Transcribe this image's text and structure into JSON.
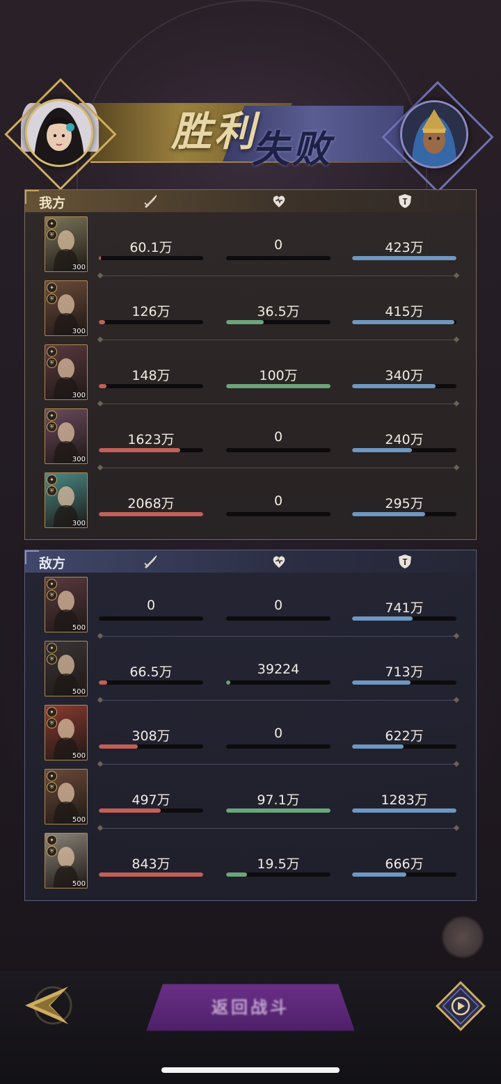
{
  "header": {
    "victory_label": "胜利",
    "defeat_label": "失败",
    "player_avatar_icon": "player-avatar",
    "enemy_avatar_icon": "enemy-avatar"
  },
  "columns": {
    "damage_icon": "sword-icon",
    "heal_icon": "heart-icon",
    "tank_icon": "shield-icon"
  },
  "colors": {
    "damage": "#c25f57",
    "heal": "#6aa67a",
    "tank": "#6d98c2",
    "gold": "#cfae5d"
  },
  "ally": {
    "title": "我方",
    "heroes": [
      {
        "level": "300",
        "damage": "60.1万",
        "heal": "0",
        "tank": "423万",
        "damage_pct": 2,
        "heal_pct": 0,
        "tank_pct": 100,
        "tint": "#7a7658"
      },
      {
        "level": "300",
        "damage": "126万",
        "heal": "36.5万",
        "tank": "415万",
        "damage_pct": 6,
        "heal_pct": 36,
        "tank_pct": 98,
        "tint": "#6a4a38"
      },
      {
        "level": "300",
        "damage": "148万",
        "heal": "100万",
        "tank": "340万",
        "damage_pct": 7,
        "heal_pct": 100,
        "tank_pct": 80,
        "tint": "#5a3a3e"
      },
      {
        "level": "300",
        "damage": "1623万",
        "heal": "0",
        "tank": "240万",
        "damage_pct": 78,
        "heal_pct": 0,
        "tank_pct": 57,
        "tint": "#6a4a5c"
      },
      {
        "level": "300",
        "damage": "2068万",
        "heal": "0",
        "tank": "295万",
        "damage_pct": 100,
        "heal_pct": 0,
        "tank_pct": 70,
        "tint": "#4a8a86"
      }
    ]
  },
  "enemy": {
    "title": "敌方",
    "heroes": [
      {
        "level": "500",
        "damage": "0",
        "heal": "0",
        "tank": "741万",
        "damage_pct": 0,
        "heal_pct": 0,
        "tank_pct": 58,
        "tint": "#5a3a3e"
      },
      {
        "level": "500",
        "damage": "66.5万",
        "heal": "39224",
        "tank": "713万",
        "damage_pct": 8,
        "heal_pct": 4,
        "tank_pct": 56,
        "tint": "#3a3436"
      },
      {
        "level": "500",
        "damage": "308万",
        "heal": "0",
        "tank": "622万",
        "damage_pct": 37,
        "heal_pct": 0,
        "tank_pct": 49,
        "tint": "#8a3a30"
      },
      {
        "level": "500",
        "damage": "497万",
        "heal": "97.1万",
        "tank": "1283万",
        "damage_pct": 59,
        "heal_pct": 100,
        "tank_pct": 100,
        "tint": "#6a4a38"
      },
      {
        "level": "500",
        "damage": "843万",
        "heal": "19.5万",
        "tank": "666万",
        "damage_pct": 100,
        "heal_pct": 20,
        "tank_pct": 52,
        "tint": "#8a8478"
      }
    ]
  },
  "bottom": {
    "back_icon": "back-arrow-icon",
    "main_button_label": "返回战斗",
    "replay_icon": "replay-icon"
  }
}
